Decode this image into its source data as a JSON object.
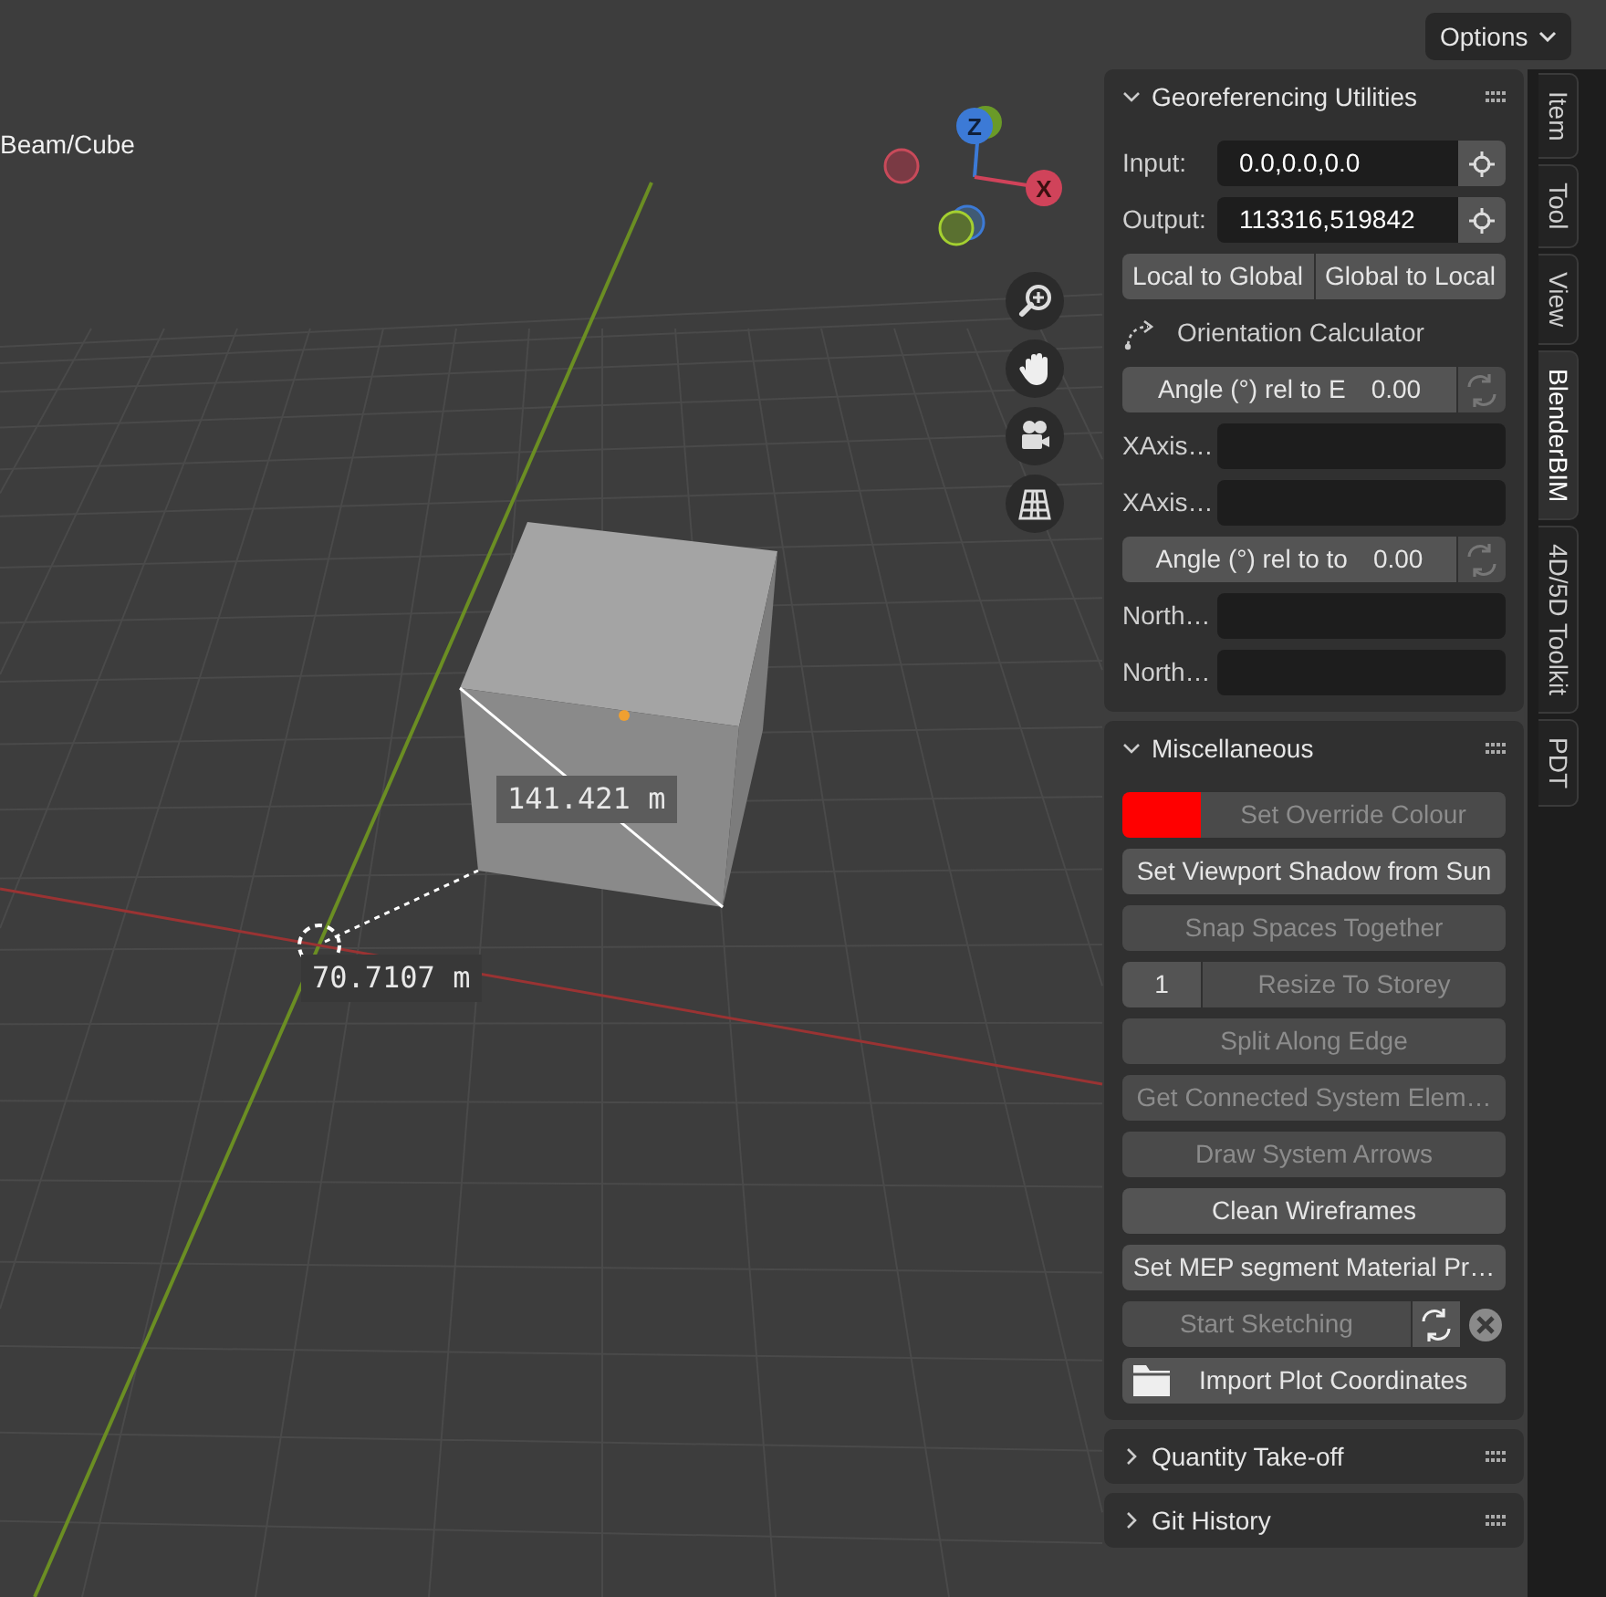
{
  "viewport": {
    "object_label": "Beam/Cube",
    "gizmo_labels": [
      "Z",
      "X"
    ],
    "measurements": [
      "141.421 m",
      "70.7107 m"
    ]
  },
  "header": {
    "options_button": "Options"
  },
  "sidebar_tabs": [
    {
      "label": "Item",
      "selected": false
    },
    {
      "label": "Tool",
      "selected": false
    },
    {
      "label": "View",
      "selected": false
    },
    {
      "label": "BlenderBIM",
      "selected": true
    },
    {
      "label": "4D/5D Toolkit",
      "selected": false
    },
    {
      "label": "PDT",
      "selected": false
    }
  ],
  "panels": [
    {
      "title": "Georeferencing Utilities",
      "expanded": true,
      "rows": [
        {
          "kind": "picker",
          "label": "Input:",
          "value": "0.0,0.0,0.0"
        },
        {
          "kind": "picker",
          "label": "Output:",
          "value": "113316,519842"
        },
        {
          "kind": "pair",
          "buttons": [
            "Local to Global",
            "Global to Local"
          ]
        },
        {
          "kind": "heading",
          "label": "Orientation Calculator"
        },
        {
          "kind": "angle",
          "label": "Angle (°) rel to E",
          "value": "0.00"
        },
        {
          "kind": "field",
          "label": "XAxis…"
        },
        {
          "kind": "field",
          "label": "XAxis…"
        },
        {
          "kind": "angle",
          "label": "Angle (°) rel to to",
          "value": "0.00"
        },
        {
          "kind": "field",
          "label": "North…"
        },
        {
          "kind": "field",
          "label": "North…"
        }
      ]
    },
    {
      "title": "Miscellaneous",
      "expanded": true,
      "rows": [
        {
          "kind": "color",
          "label": "Set Override Colour",
          "color": "#ff0000",
          "disabled": true
        },
        {
          "kind": "button",
          "label": "Set Viewport Shadow from Sun",
          "disabled": false
        },
        {
          "kind": "button",
          "label": "Snap Spaces Together",
          "disabled": true
        },
        {
          "kind": "number",
          "label": "Resize To Storey",
          "count": "1",
          "disabled": true
        },
        {
          "kind": "button",
          "label": "Split Along Edge",
          "disabled": true
        },
        {
          "kind": "button",
          "label": "Get Connected System Elem…",
          "disabled": true
        },
        {
          "kind": "button",
          "label": "Draw System Arrows",
          "disabled": true
        },
        {
          "kind": "button",
          "label": "Clean Wireframes",
          "disabled": false
        },
        {
          "kind": "button",
          "label": "Set MEP segment Material Pr…",
          "disabled": false
        },
        {
          "kind": "sketch",
          "label": "Start Sketching",
          "disabled": true
        },
        {
          "kind": "file",
          "label": "Import Plot Coordinates",
          "disabled": false
        }
      ]
    },
    {
      "title": "Quantity Take-off",
      "expanded": false
    },
    {
      "title": "Git History",
      "expanded": false
    }
  ]
}
